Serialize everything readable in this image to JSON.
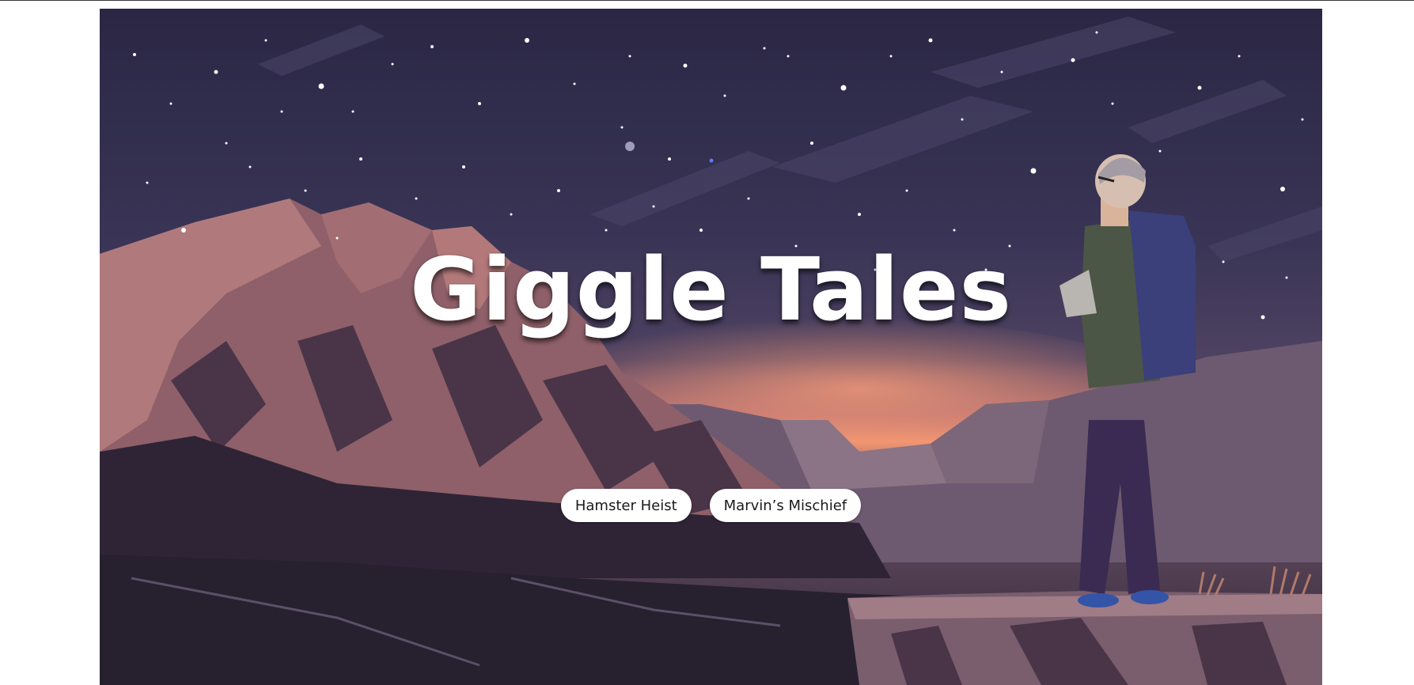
{
  "hero": {
    "title": "Giggle Tales",
    "buttons": [
      {
        "label": "Hamster Heist"
      },
      {
        "label": "Marvin’s Mischief"
      }
    ]
  },
  "colors": {
    "sky_top": "#2c2846",
    "sky_mid": "#433c5f",
    "horizon_glow": "#f0906f",
    "mountain_light": "#9c6b72",
    "mountain_dark": "#3d2f45",
    "ground": "#2a2438",
    "button_bg": "#ffffff",
    "title_color": "#ffffff"
  }
}
